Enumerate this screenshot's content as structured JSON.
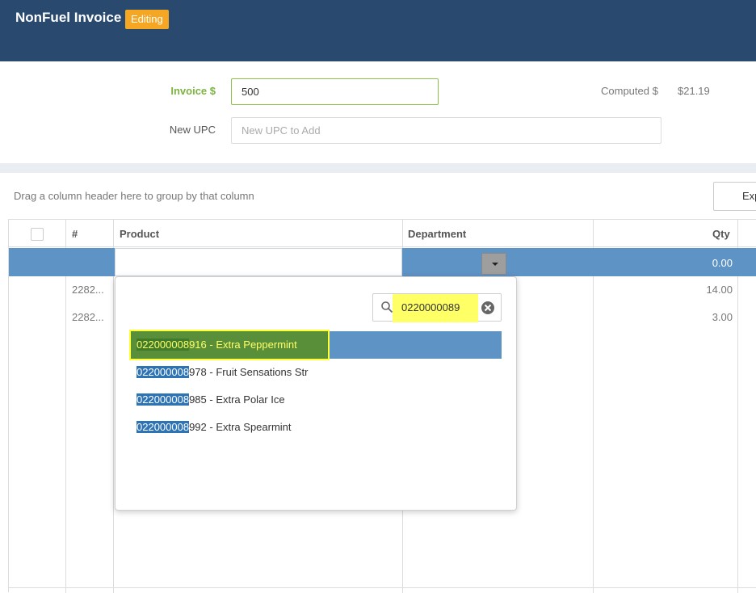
{
  "header": {
    "title": "NonFuel Invoice",
    "badge": "Editing"
  },
  "form": {
    "invoice_label": "Invoice $",
    "invoice_value": "500",
    "computed_label": "Computed $",
    "computed_value": "$21.19",
    "upc_label": "New UPC",
    "upc_placeholder": "New UPC to Add"
  },
  "grid": {
    "group_hint": "Drag a column header here to group by that column",
    "export_label": "Exp",
    "columns": [
      "#",
      "Product",
      "Department",
      "Qty"
    ],
    "selected_row": {
      "qty": "0.00"
    },
    "rows": [
      {
        "num": "2282...",
        "qty": "14.00"
      },
      {
        "num": "2282...",
        "qty": "3.00"
      }
    ]
  },
  "dropdown": {
    "search_value": "0220000089",
    "options": [
      {
        "match": "022000008",
        "rest": "916 - Extra Peppermint"
      },
      {
        "match": "022000008",
        "rest": "978 - Fruit Sensations Str"
      },
      {
        "match": "022000008",
        "rest": "985 - Extra Polar Ice"
      },
      {
        "match": "022000008",
        "rest": "992 - Extra Spearmint"
      }
    ]
  },
  "colors": {
    "header_bg": "#294a6e",
    "badge_bg": "#f5a623",
    "selection_blue": "#5e93c5",
    "highlight_yellow": "#ffff66",
    "invoice_green": "#7cb342"
  }
}
